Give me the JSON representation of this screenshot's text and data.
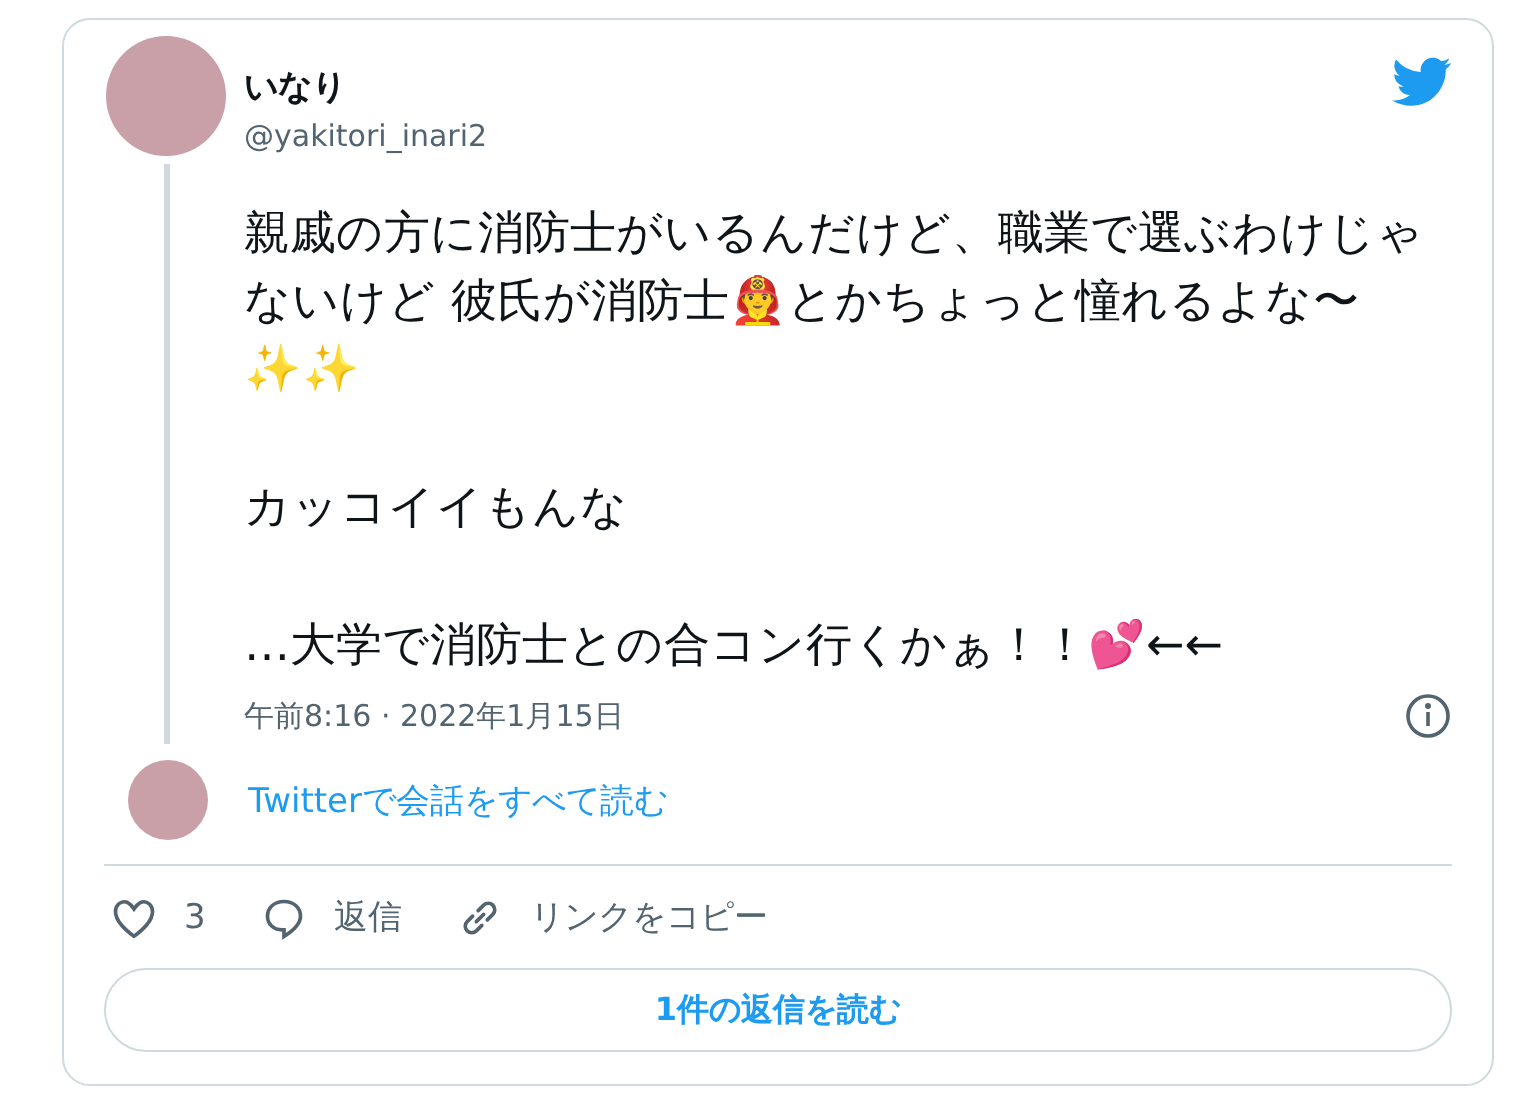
{
  "author": {
    "name": "いなり",
    "handle": "@yakitori_inari2"
  },
  "body": [
    "親戚の方に消防士がいるんだけど、職業で選ぶわけじゃないけど 彼氏が消防士👨‍🚒とかちょっと憧れるよな〜✨✨",
    "カッコイイもんな",
    "…大学で消防士との合コン行くかぁ！！💕←←"
  ],
  "timestamp": "午前8:16 · 2022年1月15日",
  "thread_link": "Twitterで会話をすべて読む",
  "actions": [
    {
      "kind": "like",
      "label": "3"
    },
    {
      "kind": "reply",
      "label": "返信"
    },
    {
      "kind": "link",
      "label": "リンクをコピー"
    }
  ],
  "replies_button": "1件の返信を読む"
}
